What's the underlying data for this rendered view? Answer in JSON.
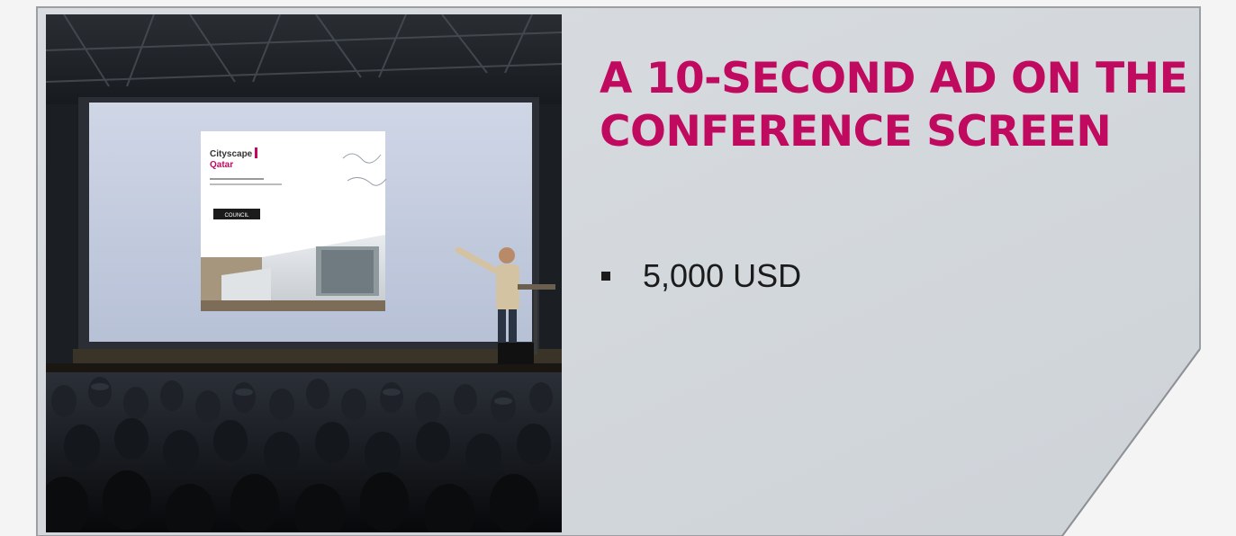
{
  "slide": {
    "headline": "A 10-SECOND AD ON THE CONFERENCE SCREEN",
    "bullets": [
      {
        "text": "5,000 USD"
      }
    ],
    "colors": {
      "accent": "#c00a5f",
      "panel": "#d4d8dc",
      "text": "#1b1b1b"
    }
  },
  "photo": {
    "screen_ad": {
      "brand_line1": "Cityscape",
      "brand_line2": "Qatar",
      "button_label": "COUNCIL"
    }
  }
}
